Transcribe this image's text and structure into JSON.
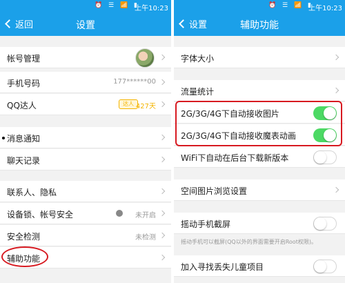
{
  "status": {
    "icons": "⏰ ☰ 📶 ▮",
    "time": "上午10:23"
  },
  "left": {
    "back": "返回",
    "title": "设置",
    "rows": {
      "account": "帐号管理",
      "phone": "手机号码",
      "phone_value": "177******00",
      "qq_daren": "QQ达人",
      "qq_badge": "达人",
      "qq_days": "427天",
      "notify": "消息通知",
      "chat": "聊天记录",
      "contacts": "联系人、隐私",
      "device": "设备锁、帐号安全",
      "device_value": "未开启",
      "security": "安全检测",
      "security_value": "未检测",
      "accessibility": "辅助功能"
    }
  },
  "right": {
    "back": "设置",
    "title": "辅助功能",
    "rows": {
      "font": "字体大小",
      "traffic": "流量统计",
      "auto_image": "2G/3G/4G下自动接收图片",
      "auto_emoji": "2G/3G/4G下自动接收魔表动画",
      "wifi_update": "WiFi下自动在后台下载新版本",
      "space_browse": "空间图片浏览设置",
      "shake": "摇动手机截屏",
      "shake_hint": "摇动手机可以截屏(QQ以外的界面需要开启Root权限)。",
      "child": "加入寻找丢失儿童项目"
    }
  },
  "colors": {
    "header": "#1ba0e9",
    "toggle_on": "#4cd964",
    "highlight": "#d71920"
  }
}
